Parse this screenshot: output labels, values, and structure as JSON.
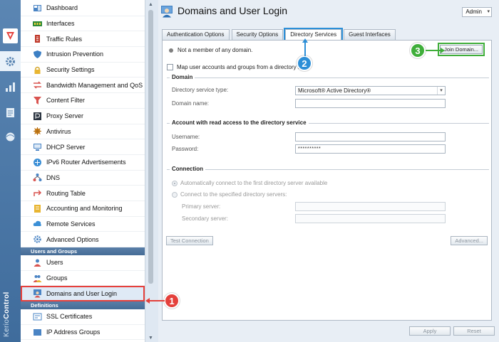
{
  "app": {
    "product_name_light": "Kerio",
    "product_name_bold": "Control",
    "user_label": "Admin"
  },
  "sidebar": {
    "items": [
      {
        "label": "Dashboard",
        "icon": "dashboard-icon"
      },
      {
        "label": "Interfaces",
        "icon": "interfaces-icon"
      },
      {
        "label": "Traffic Rules",
        "icon": "traffic-rules-icon"
      },
      {
        "label": "Intrusion Prevention",
        "icon": "shield-icon"
      },
      {
        "label": "Security Settings",
        "icon": "lock-icon"
      },
      {
        "label": "Bandwidth Management and QoS",
        "icon": "bandwidth-icon"
      },
      {
        "label": "Content Filter",
        "icon": "filter-icon"
      },
      {
        "label": "Proxy Server",
        "icon": "proxy-icon"
      },
      {
        "label": "Antivirus",
        "icon": "antivirus-icon"
      },
      {
        "label": "DHCP Server",
        "icon": "dhcp-icon"
      },
      {
        "label": "IPv6 Router Advertisements",
        "icon": "ipv6-icon"
      },
      {
        "label": "DNS",
        "icon": "dns-icon"
      },
      {
        "label": "Routing Table",
        "icon": "routing-icon"
      },
      {
        "label": "Accounting and Monitoring",
        "icon": "accounting-icon"
      },
      {
        "label": "Remote Services",
        "icon": "cloud-icon"
      },
      {
        "label": "Advanced Options",
        "icon": "advanced-icon"
      }
    ],
    "section_users": "Users and Groups",
    "users_items": [
      {
        "label": "Users",
        "icon": "user-icon"
      },
      {
        "label": "Groups",
        "icon": "groups-icon"
      },
      {
        "label": "Domains and User Login",
        "icon": "domain-user-icon"
      }
    ],
    "section_definitions": "Definitions",
    "definitions_items": [
      {
        "label": "SSL Certificates",
        "icon": "certificate-icon"
      },
      {
        "label": "IP Address Groups",
        "icon": "ip-groups-icon"
      }
    ]
  },
  "page": {
    "title": "Domains and User Login",
    "tabs": [
      "Authentication Options",
      "Security Options",
      "Directory Services",
      "Guest Interfaces"
    ],
    "active_tab": "Directory Services",
    "status_text": "Not a member of any domain.",
    "join_button": "Join Domain...",
    "map_checkbox_label": "Map user accounts and groups from a directory se",
    "domain_section": {
      "legend": "Domain",
      "type_label": "Directory service type:",
      "type_value": "Microsoft® Active Directory®",
      "name_label": "Domain name:",
      "name_value": ""
    },
    "account_section": {
      "legend": "Account with read access to the directory service",
      "username_label": "Username:",
      "username_value": "",
      "password_label": "Password:",
      "password_value": "**********"
    },
    "connection_section": {
      "legend": "Connection",
      "auto_label": "Automatically connect to the first directory server available",
      "specified_label": "Connect to the specified directory servers:",
      "primary_label": "Primary server:",
      "primary_value": "",
      "secondary_label": "Secondary server:",
      "secondary_value": ""
    },
    "test_button": "Test Connection",
    "advanced_button": "Advanced...",
    "apply_button": "Apply",
    "reset_button": "Reset"
  },
  "callouts": [
    "1",
    "2",
    "3"
  ],
  "colors": {
    "rail": "#4a77a6",
    "callout_1": "#e4403b",
    "callout_2": "#2d8fd7",
    "callout_3": "#3fae3a"
  }
}
